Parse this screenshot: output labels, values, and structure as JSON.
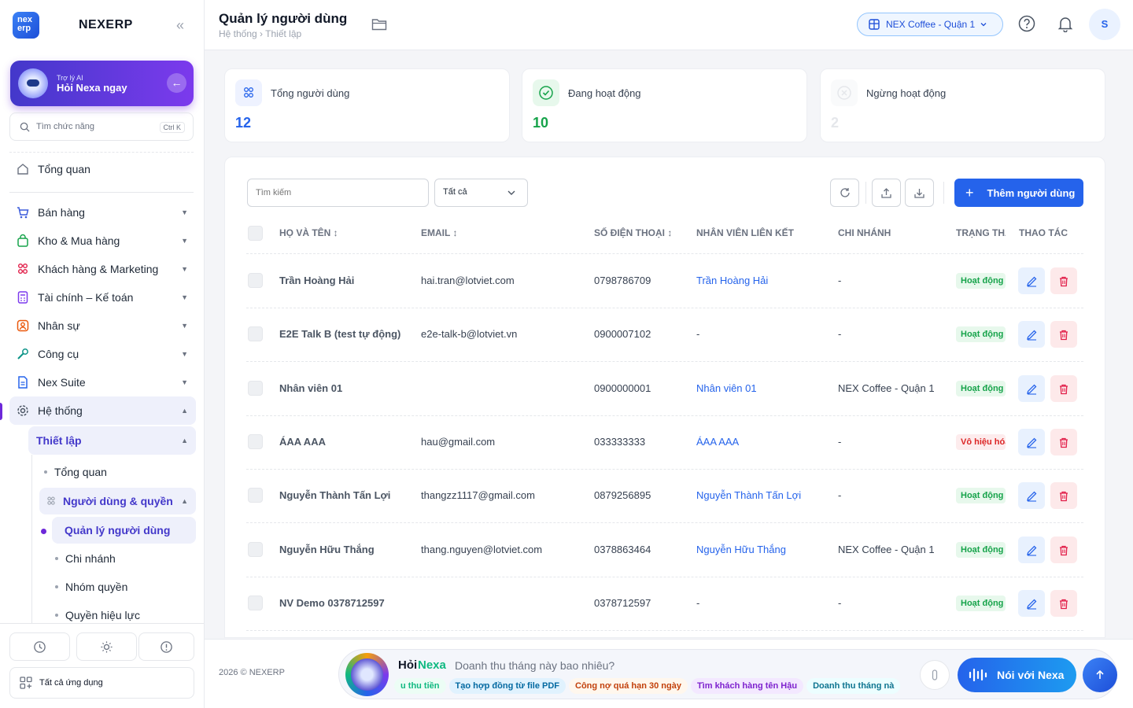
{
  "sidebar": {
    "logo_text": "nex erp",
    "brand": "NEXERP",
    "ai_small": "Trợ lý AI",
    "ai_big": "Hỏi Nexa ngay",
    "search_placeholder": "Tìm chức năng",
    "search_shortcut": "Ctrl K",
    "overview": "Tổng quan",
    "items": [
      {
        "label": "Bán hàng",
        "icon": "cart-icon",
        "color": "#3b5bdb"
      },
      {
        "label": "Kho & Mua hàng",
        "icon": "bag-icon",
        "color": "#16a34a"
      },
      {
        "label": "Khách hàng & Marketing",
        "icon": "users-icon",
        "color": "#e11d48"
      },
      {
        "label": "Tài chính – Kế toán",
        "icon": "calculator-icon",
        "color": "#7c3aed"
      },
      {
        "label": "Nhân sự",
        "icon": "person-icon",
        "color": "#ea580c"
      },
      {
        "label": "Công cụ",
        "icon": "wrench-icon",
        "color": "#0d9488"
      },
      {
        "label": "Nex Suite",
        "icon": "document-icon",
        "color": "#2563eb"
      },
      {
        "label": "Hệ thống",
        "icon": "gear-icon",
        "color": "#4b5563"
      }
    ],
    "setup": "Thiết lập",
    "sub_overview": "Tổng quan",
    "users_perms": "Người dùng & quyền",
    "user_mgmt": "Quản lý người dùng",
    "branch": "Chi nhánh",
    "role_group": "Nhóm quyền",
    "effective": "Quyền hiệu lực",
    "all_apps": "Tất cả ứng dụng"
  },
  "header": {
    "title": "Quản lý người dùng",
    "breadcrumb": "Hệ thống › Thiết lập",
    "branch": "NEX Coffee - Quận 1",
    "user_initial": "S"
  },
  "stats": [
    {
      "label": "Tổng người dùng",
      "value": "12",
      "color": "#2563eb"
    },
    {
      "label": "Đang hoạt động",
      "value": "10",
      "color": "#16a34a"
    },
    {
      "label": "Ngừng hoạt động",
      "value": "2",
      "color": "#e5e7eb"
    }
  ],
  "filters": {
    "search_placeholder": "Tìm kiếm",
    "status_value": "Tất cả",
    "add_button": "Thêm người dùng"
  },
  "table": {
    "headers": [
      "HỌ VÀ TÊN ↕",
      "EMAIL ↕",
      "SỐ ĐIỆN THOẠI ↕",
      "NHÂN VIÊN LIÊN KẾT",
      "CHI NHÁNH",
      "TRẠNG THÁI",
      "THAO TÁC"
    ],
    "rows": [
      {
        "name": "Trần Hoàng Hải",
        "email": "hai.tran@lotviet.com",
        "phone": "0798786709",
        "employee": "Trần Hoàng Hải",
        "branch": "-",
        "status": "Hoạt động",
        "status_kind": "ok"
      },
      {
        "name": "E2E Talk B (test tự động)",
        "email": "e2e-talk-b@lotviet.vn",
        "phone": "0900007102",
        "employee": "-",
        "branch": "-",
        "status": "Hoạt động",
        "status_kind": "ok"
      },
      {
        "name": "Nhân viên 01",
        "email": "",
        "phone": "0900000001",
        "employee": "Nhân viên 01",
        "branch": "NEX Coffee - Quận 1",
        "status": "Hoạt động",
        "status_kind": "ok"
      },
      {
        "name": "ÁAA AAA",
        "email": "hau@gmail.com",
        "phone": "033333333",
        "employee": "ÁAA AAA",
        "branch": "-",
        "status": "Vô hiệu hóa",
        "status_kind": "off"
      },
      {
        "name": "Nguyễn Thành Tấn Lợi",
        "email": "thangzz1117@gmail.com",
        "phone": "0879256895",
        "employee": "Nguyễn Thành Tấn Lợi",
        "branch": "-",
        "status": "Hoạt động",
        "status_kind": "ok"
      },
      {
        "name": "Nguyễn Hữu Thắng",
        "email": "thang.nguyen@lotviet.com",
        "phone": "0378863464",
        "employee": "Nguyễn Hữu Thắng",
        "branch": "NEX Coffee - Quận 1",
        "status": "Hoạt động",
        "status_kind": "ok"
      },
      {
        "name": "NV Demo 0378712597",
        "email": "",
        "phone": "0378712597",
        "employee": "-",
        "branch": "-",
        "status": "Hoạt động",
        "status_kind": "ok"
      }
    ]
  },
  "footer": {
    "copyright": "2026 © NEXERP",
    "nexa_hoi": "Hỏi",
    "nexa_name": "Nexa",
    "question": "Doanh thu tháng này bao nhiêu?",
    "chips": [
      {
        "label": "u thu tiền",
        "bg": "#ecfdf5",
        "fg": "#10b981"
      },
      {
        "label": "Tạo hợp đồng từ file PDF",
        "bg": "#e0f2fe",
        "fg": "#0369a1"
      },
      {
        "label": "Công nợ quá hạn 30 ngày",
        "bg": "#fff7ed",
        "fg": "#c2410c"
      },
      {
        "label": "Tìm khách hàng tên Hậu",
        "bg": "#f3e8ff",
        "fg": "#7e22ce"
      },
      {
        "label": "Doanh thu tháng nà",
        "bg": "#ecfeff",
        "fg": "#0e7490"
      }
    ],
    "speak": "Nói với Nexa"
  }
}
